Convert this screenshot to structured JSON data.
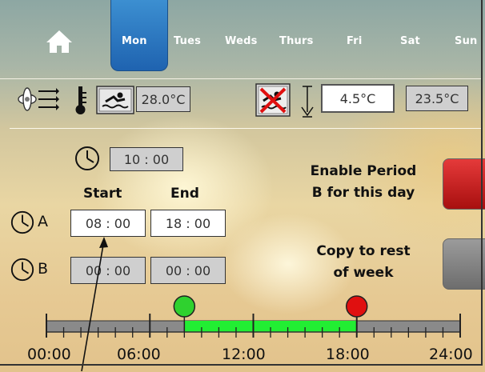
{
  "header": {
    "days": [
      "Mon",
      "Tues",
      "Weds",
      "Thurs",
      "Fri",
      "Sat",
      "Sun"
    ],
    "active_day": "Mon"
  },
  "pool": {
    "current_temp": "28.0°C",
    "setback_low": "4.5°C",
    "setback_high": "23.5°C"
  },
  "schedule": {
    "boost_time": "10 : 00",
    "start_label": "Start",
    "end_label": "End",
    "period_a_label": "A",
    "period_a_start": "08 : 00",
    "period_a_end": "18 : 00",
    "period_b_label": "B",
    "period_b_start": "00 : 00",
    "period_b_end": "00 : 00"
  },
  "buttons": {
    "enable_period_b_line1": "Enable Period",
    "enable_period_b_line2": "B for this day",
    "copy_line1": "Copy to rest",
    "copy_line2": "of week"
  },
  "timeline": {
    "ticks": [
      "00:00",
      "06:00",
      "12:00",
      "18:00",
      "24:00"
    ],
    "range_hours": [
      0,
      24
    ],
    "on_start_hours": 8,
    "on_end_hours": 18,
    "on_color": "#22ee33",
    "off_color": "#8a8a8a",
    "start_marker_color": "#2fd12f",
    "end_marker_color": "#e01010"
  },
  "colors": {
    "active_tab": "#2a74c2",
    "enable_button": "#c81e1e",
    "copy_button": "#888888"
  },
  "icons": {
    "home": "home-icon",
    "fan": "fan-icon",
    "thermometer": "thermometer-icon",
    "swimmer": "swimmer-icon",
    "no_swimming": "no-swimming-icon",
    "clock": "clock-icon",
    "down_arrow": "down-arrow-icon"
  }
}
